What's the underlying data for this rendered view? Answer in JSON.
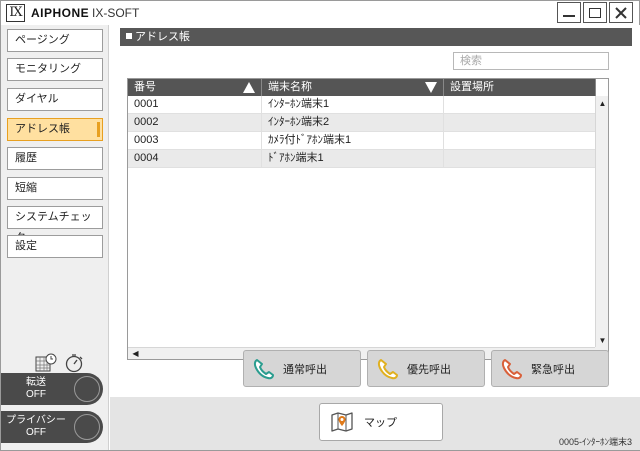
{
  "titlebar": {
    "logo": "IX",
    "brand": "AIPHONE",
    "product": "IX-SOFT"
  },
  "sidebar": {
    "items": [
      {
        "label": "ページング"
      },
      {
        "label": "モニタリング"
      },
      {
        "label": "ダイヤル"
      },
      {
        "label": "アドレス帳",
        "active": true
      },
      {
        "label": "履歴"
      },
      {
        "label": "短縮"
      },
      {
        "label": "システムチェック"
      },
      {
        "label": "設定"
      }
    ],
    "icons": [
      "calendar-clock-icon",
      "timer-icon"
    ],
    "forward": {
      "label": "転送",
      "state": "OFF"
    },
    "privacy": {
      "label": "プライバシー",
      "state": "OFF"
    }
  },
  "main": {
    "section_title": "アドレス帳",
    "search": {
      "placeholder": "検索",
      "value": ""
    },
    "table": {
      "headers": [
        "番号",
        "端末名称",
        "設置場所"
      ],
      "rows": [
        [
          "0001",
          "ｲﾝﾀｰﾎﾝ端末1",
          ""
        ],
        [
          "0002",
          "ｲﾝﾀｰﾎﾝ端末2",
          ""
        ],
        [
          "0003",
          "ｶﾒﾗ付ﾄﾞｱﾎﾝ端末1",
          ""
        ],
        [
          "0004",
          "ﾄﾞｱﾎﾝ端末1",
          ""
        ]
      ]
    },
    "buttons": {
      "normal_call": "通常呼出",
      "priority_call": "優先呼出",
      "emergency_call": "緊急呼出",
      "map": "マップ"
    },
    "status": "0005-ｲﾝﾀｰﾎﾝ端末3"
  },
  "colors": {
    "active_nav_bg": "#ffe0a0",
    "active_nav_accent": "#e8a020",
    "header_bg": "#575757",
    "normal_call_icon": "#2a9d8f",
    "priority_call_icon": "#e0b020",
    "emergency_call_icon": "#d9603a"
  }
}
